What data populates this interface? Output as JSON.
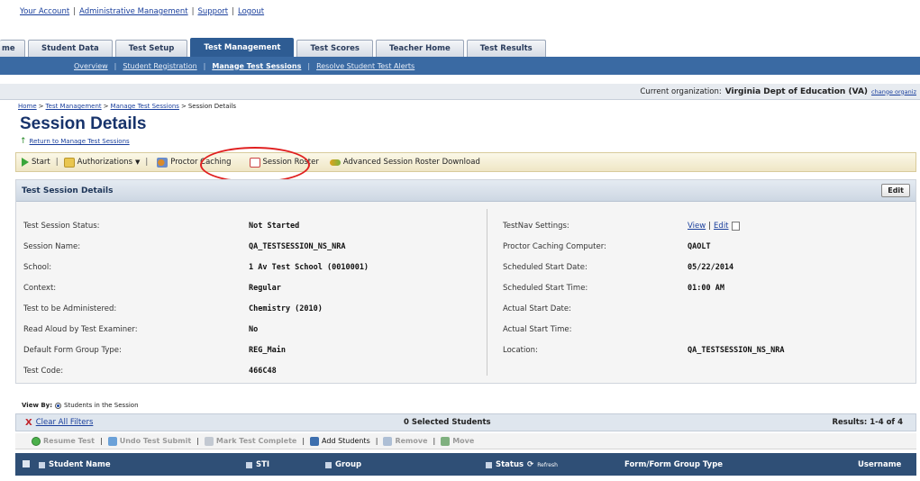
{
  "top_links": [
    "Your Account",
    "Administrative Management",
    "Support",
    "Logout"
  ],
  "tabs": [
    {
      "label": "me",
      "active": false
    },
    {
      "label": "Student Data",
      "active": false
    },
    {
      "label": "Test Setup",
      "active": false
    },
    {
      "label": "Test Management",
      "active": true
    },
    {
      "label": "Test Scores",
      "active": false
    },
    {
      "label": "Teacher Home",
      "active": false
    },
    {
      "label": "Test Results",
      "active": false
    }
  ],
  "subnav": [
    {
      "label": "Overview",
      "active": false
    },
    {
      "label": "Student Registration",
      "active": false
    },
    {
      "label": "Manage Test Sessions",
      "active": true
    },
    {
      "label": "Resolve Student Test Alerts",
      "active": false
    }
  ],
  "org": {
    "label": "Current organization:",
    "name": "Virginia Dept of Education (VA)",
    "change": "change organiz"
  },
  "breadcrumb": [
    "Home",
    "Test Management",
    "Manage Test Sessions",
    "Session Details"
  ],
  "page": {
    "title": "Session Details",
    "return_link": "Return to Manage Test Sessions"
  },
  "toolbar": {
    "start": "Start",
    "authorizations": "Authorizations",
    "proctor_caching": "Proctor Caching",
    "session_roster": "Session Roster",
    "advanced_roster": "Advanced Session Roster Download"
  },
  "panel": {
    "title": "Test Session Details",
    "edit": "Edit",
    "left": [
      {
        "label": "Test Session Status:",
        "value": "Not Started"
      },
      {
        "label": "Session Name:",
        "value": "QA_TESTSESSION_NS_NRA"
      },
      {
        "label": "School:",
        "value": "1 Av Test School (0010001)"
      },
      {
        "label": "Context:",
        "value": "Regular"
      },
      {
        "label": "Test to be Administered:",
        "value": "Chemistry (2010)"
      },
      {
        "label": "Read Aloud by Test Examiner:",
        "value": "No"
      },
      {
        "label": "Default Form Group Type:",
        "value": "REG_Main"
      },
      {
        "label": "Test Code:",
        "value": "466C48"
      }
    ],
    "right": [
      {
        "label": "TestNav Settings:",
        "value": ""
      },
      {
        "label": "Proctor Caching Computer:",
        "value": "QAOLT"
      },
      {
        "label": "Scheduled Start Date:",
        "value": "05/22/2014"
      },
      {
        "label": "Scheduled Start Time:",
        "value": "01:00 AM"
      },
      {
        "label": "Actual Start Date:",
        "value": ""
      },
      {
        "label": "Actual Start Time:",
        "value": ""
      },
      {
        "label": "Location:",
        "value": "QA_TESTSESSION_NS_NRA"
      }
    ],
    "testnav_view": "View",
    "testnav_edit": "Edit"
  },
  "view_by": {
    "label": "View By:",
    "option": "Students in the Session"
  },
  "filters": {
    "clear": "Clear All Filters",
    "selected": "0 Selected Students",
    "results": "Results: 1-4 of 4"
  },
  "actions": {
    "resume": "Resume Test",
    "undo": "Undo Test Submit",
    "mark": "Mark Test Complete",
    "add": "Add Students",
    "remove": "Remove",
    "move": "Move"
  },
  "table": {
    "columns": [
      "Student Name",
      "STI",
      "Group",
      "Status",
      "Form/Form Group Type",
      "Username"
    ],
    "refresh": "Refresh"
  }
}
